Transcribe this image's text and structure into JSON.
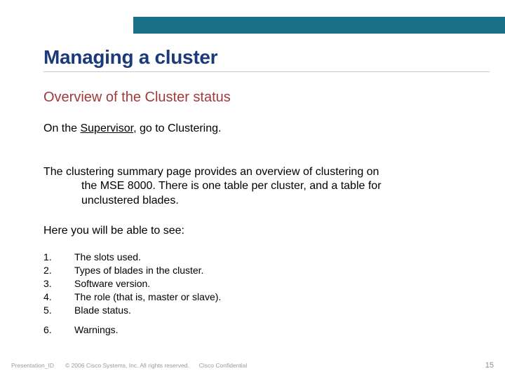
{
  "header": {
    "title": "Managing a cluster",
    "subtitle": "Overview of the Cluster status"
  },
  "body": {
    "line1_prefix": "On the ",
    "line1_link": "Supervisor",
    "line1_suffix": ", go to Clustering.",
    "para2_first": "The clustering summary page provides an overview of clustering on",
    "para2_rest1": "the MSE 8000. There is one table per cluster, and a table for",
    "para2_rest2": "unclustered blades.",
    "para3": "Here you will be able to see:"
  },
  "list": [
    {
      "n": "1.",
      "t": "The slots used."
    },
    {
      "n": "2.",
      "t": "Types of blades in the cluster."
    },
    {
      "n": "3.",
      "t": "Software version."
    },
    {
      "n": "4.",
      "t": "The role (that is, master or slave)."
    },
    {
      "n": "5.",
      "t": "Blade status."
    },
    {
      "n": "6.",
      "t": "Warnings."
    }
  ],
  "footer": {
    "presentation_id": "Presentation_ID",
    "copyright": "© 2006 Cisco Systems, Inc. All rights reserved.",
    "confidential": "Cisco Confidential",
    "page": "15"
  }
}
